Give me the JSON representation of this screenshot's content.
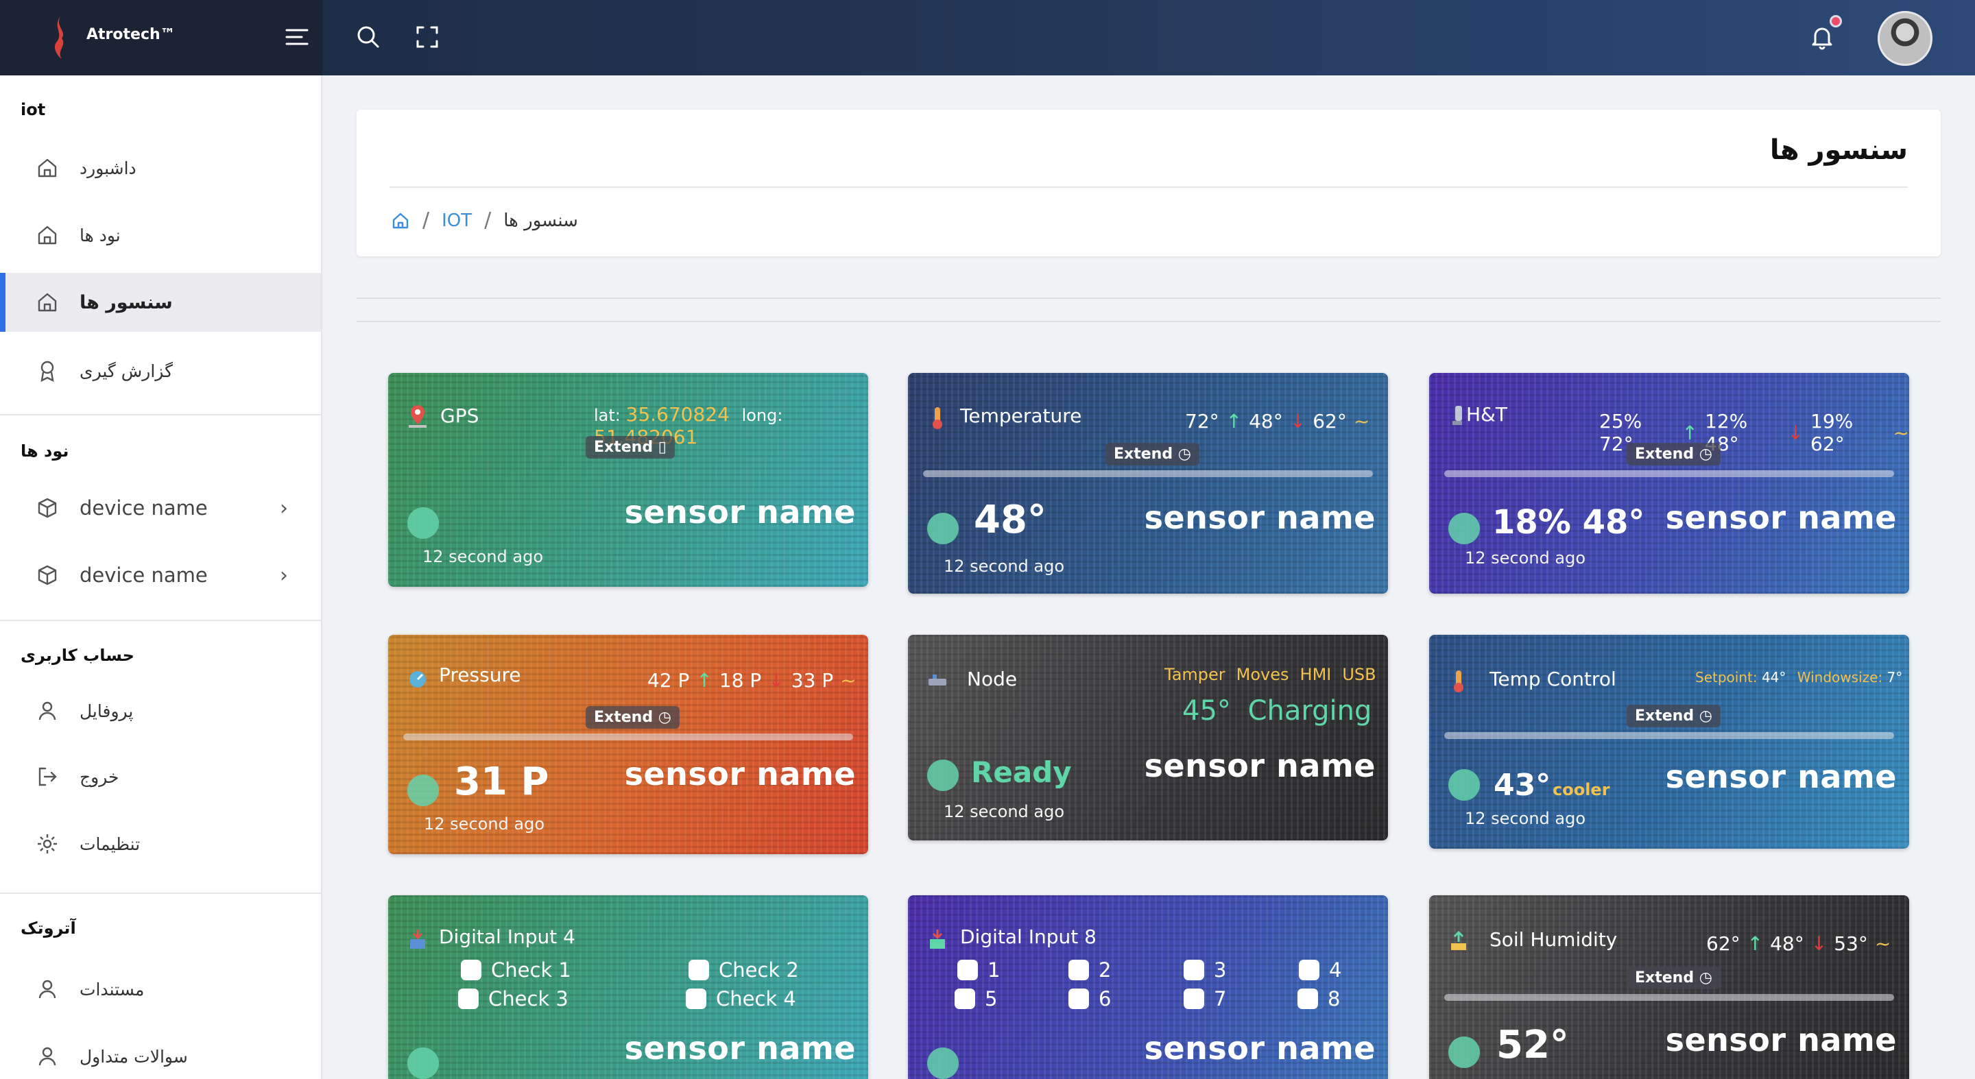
{
  "app": {
    "brand": "Atrotech™"
  },
  "sidebar": {
    "section_iot": "iot",
    "iot_items": [
      {
        "label": "داشبورد"
      },
      {
        "label": "نود ها"
      },
      {
        "label": "سنسور ها"
      },
      {
        "label": "گزارش گیری"
      }
    ],
    "section_nodes": "نود ها",
    "devices": [
      {
        "label": "device name"
      },
      {
        "label": "device name"
      }
    ],
    "section_account": "حساب کاربری",
    "account_items": [
      {
        "label": "پروفایل"
      },
      {
        "label": "خروج"
      },
      {
        "label": "تنظیمات"
      }
    ],
    "section_atrotech": "آتروتک",
    "atrotech_items": [
      {
        "label": "مستندات"
      },
      {
        "label": "سوالات متداول"
      }
    ]
  },
  "page": {
    "title": "سنسور ها",
    "breadcrumb": {
      "link": "IOT",
      "current": "سنسور ها"
    }
  },
  "cards": {
    "gps": {
      "title": "GPS",
      "lat_label": "lat:",
      "lat": "35.670824",
      "long_label": "long:",
      "long": "51.482061",
      "extend": "Extend",
      "name": "sensor name",
      "ago": "12 second ago",
      "color": "#3a9a78"
    },
    "temperature": {
      "title": "Temperature",
      "v1": "72°",
      "v2": "48°",
      "v3": "62°",
      "extend": "Extend",
      "big": "48°",
      "name": "sensor name",
      "ago": "12 second ago",
      "color": "#2e4f86"
    },
    "ht": {
      "title": "H&T",
      "v1": "25% 72°",
      "v2": "12% 48°",
      "v3": "19% 62°",
      "extend": "Extend",
      "big": "18% 48°",
      "name": "sensor name",
      "ago": "12 second ago",
      "color": "#4b3fa8"
    },
    "pressure": {
      "title": "Pressure",
      "v1": "42 P",
      "v2": "18 P",
      "v3": "33 P",
      "extend": "Extend",
      "big": "31 P",
      "name": "sensor name",
      "ago": "12 second ago",
      "color": "#d4622a"
    },
    "node": {
      "title": "Node",
      "tags": [
        "Tamper",
        "Moves",
        "HMI",
        "USB"
      ],
      "temp": "45°",
      "charging": "Charging",
      "status": "Ready",
      "name": "sensor name",
      "ago": "12 second ago",
      "color": "#3a3a3e"
    },
    "temp_control": {
      "title": "Temp Control",
      "setpoint_label": "Setpoint:",
      "setpoint": "44°",
      "window_label": "Windowsize:",
      "window": "7°",
      "extend": "Extend",
      "big": "43°",
      "mode": "cooler",
      "name": "sensor name",
      "ago": "12 second ago",
      "color": "#2c5f93"
    },
    "digital4": {
      "title": "Digital Input 4",
      "checks": [
        "Check 1",
        "Check 2",
        "Check 3",
        "Check 4"
      ],
      "name": "sensor name",
      "color": "#3a9a78"
    },
    "digital8": {
      "title": "Digital Input 8",
      "checks": [
        "1",
        "2",
        "3",
        "4",
        "5",
        "6",
        "7",
        "8"
      ],
      "name": "sensor name",
      "color": "#4b3fa8"
    },
    "soil": {
      "title": "Soil Humidity",
      "v1": "62°",
      "v2": "48°",
      "v3": "53°",
      "extend": "Extend",
      "big": "52°",
      "name": "sensor name",
      "color": "#3a3a3e"
    }
  }
}
